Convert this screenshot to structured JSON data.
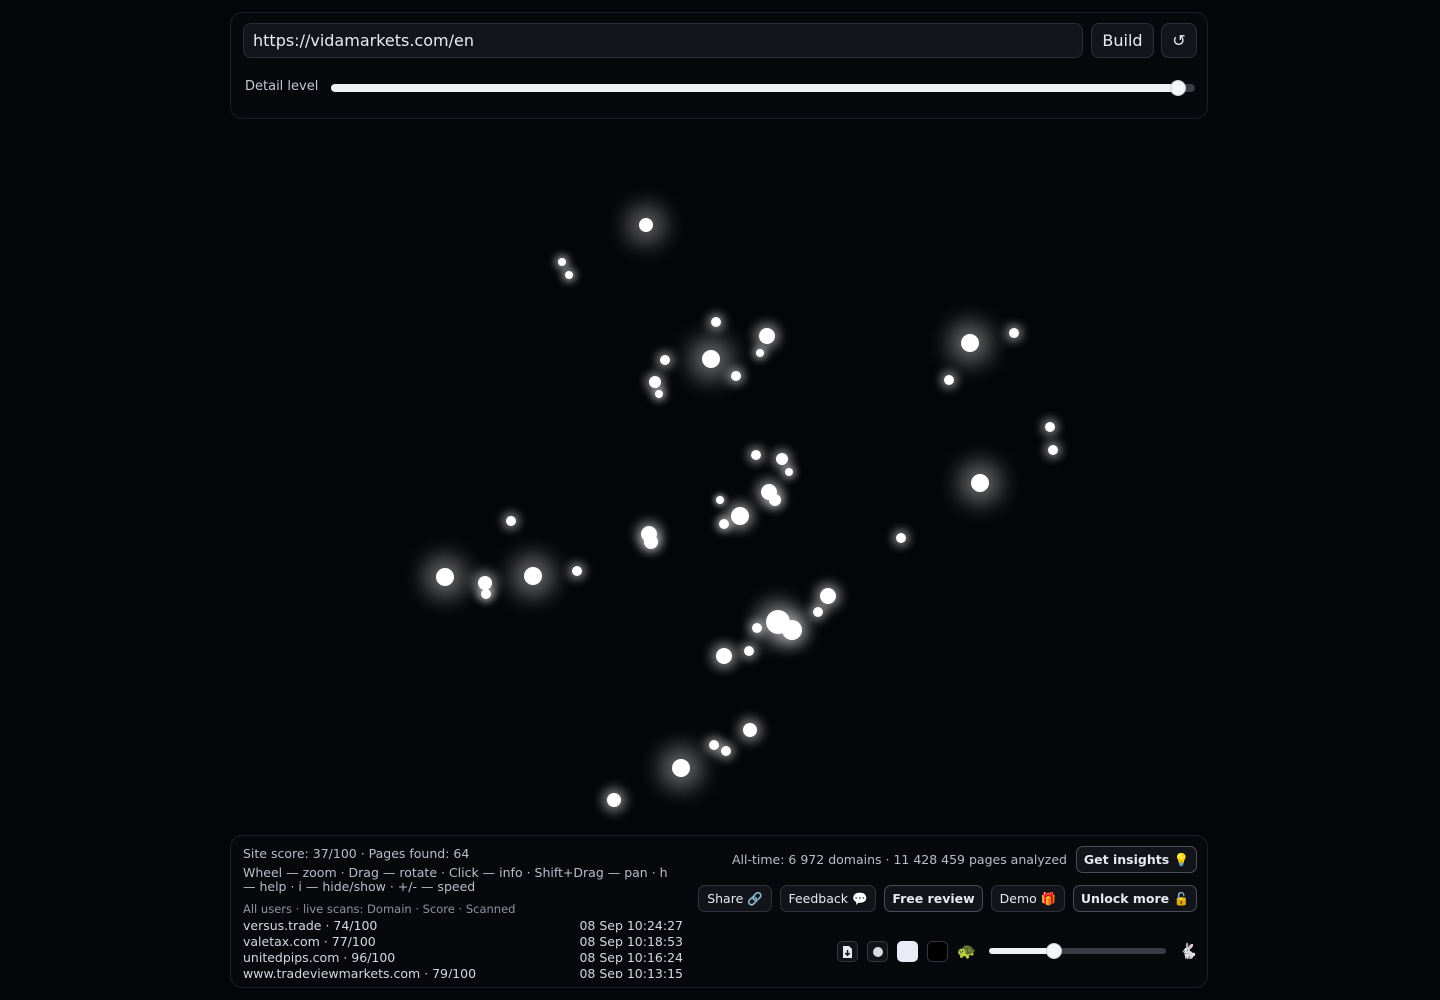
{
  "top_bar": {
    "url_value": "https://vidamarkets.com/en",
    "build_label": "Build",
    "reset_icon": "↺",
    "detail_label": "Detail level",
    "detail_value": 0.98
  },
  "status": {
    "stats": "Site score: 37/100 · Pages found: 64",
    "help": "Wheel — zoom · Drag — rotate · Click — info · Shift+Drag — pan · h — help · i — hide/show · +/- — speed",
    "scans_header": "All users · live scans: Domain · Score · Scanned",
    "scans": [
      {
        "domain": "versus.trade · 74/100",
        "time": "08 Sep 10:24:27"
      },
      {
        "domain": "valetax.com · 77/100",
        "time": "08 Sep 10:18:53"
      },
      {
        "domain": "unitedpips.com · 96/100",
        "time": "08 Sep 10:16:24"
      },
      {
        "domain": "www.tradeviewmarkets.com · 79/100",
        "time": "08 Sep 10:13:15"
      }
    ],
    "alltime": "All-time: 6 972 domains · 11 428 459 pages analyzed"
  },
  "actions": {
    "insights": "Get insights 💡",
    "share": "Share 🔗",
    "feedback": "Feedback 💬",
    "review": "Free review",
    "demo": "Demo 🎁",
    "unlock": "Unlock more 🔓"
  },
  "controls": {
    "turtle": "🐢",
    "rabbit": "🐇",
    "speed_value": 0.37
  },
  "colors": {
    "background": "#040508",
    "node": "#ffffff",
    "panel_border": "#1c1f27"
  }
}
